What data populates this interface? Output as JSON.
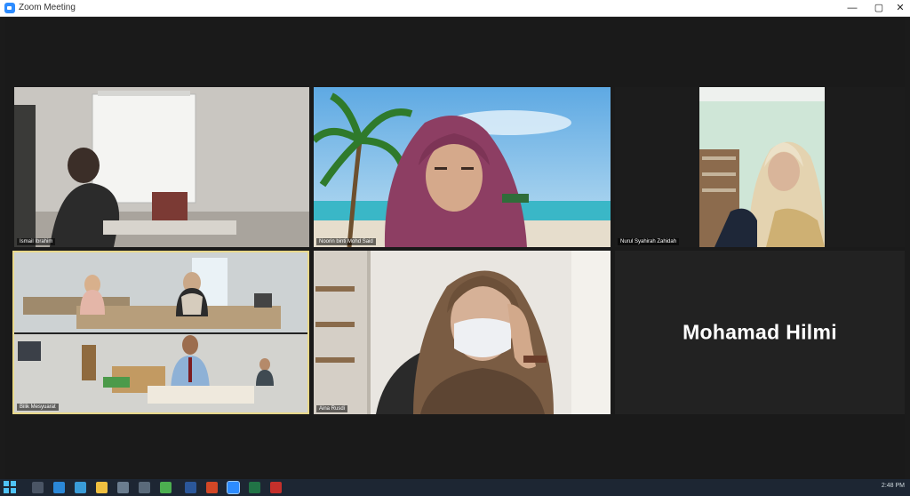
{
  "window": {
    "title": "Zoom Meeting",
    "controls": {
      "minimize": "—",
      "maximize": "▢",
      "close": "✕"
    }
  },
  "participants": [
    {
      "id": "p1",
      "name": "Ismail Ibrahim",
      "has_video": true
    },
    {
      "id": "p2",
      "name": "Noorin binti Mohd Said",
      "has_video": true
    },
    {
      "id": "p3",
      "name": "Nurul Syahirah Zahidah",
      "has_video": true
    },
    {
      "id": "p4",
      "name": "Bilik Mesyuarat",
      "has_video": true,
      "active_speaker": true
    },
    {
      "id": "p5",
      "name": "Aina Rusdi",
      "has_video": true
    },
    {
      "id": "p6",
      "name": "Mohamad Hilmi",
      "has_video": false
    }
  ],
  "taskbar": {
    "items": [
      "search-icon",
      "task-view-icon",
      "edge-icon",
      "file-explorer-icon",
      "mail-icon",
      "store-icon",
      "chrome-icon",
      "word-icon",
      "powerpoint-icon",
      "zoom-icon",
      "excel-icon",
      "acrobat-icon"
    ],
    "clock": "2:48 PM"
  },
  "colors": {
    "active_speaker_border": "#e8d88a",
    "accent": "#2d8cff"
  }
}
